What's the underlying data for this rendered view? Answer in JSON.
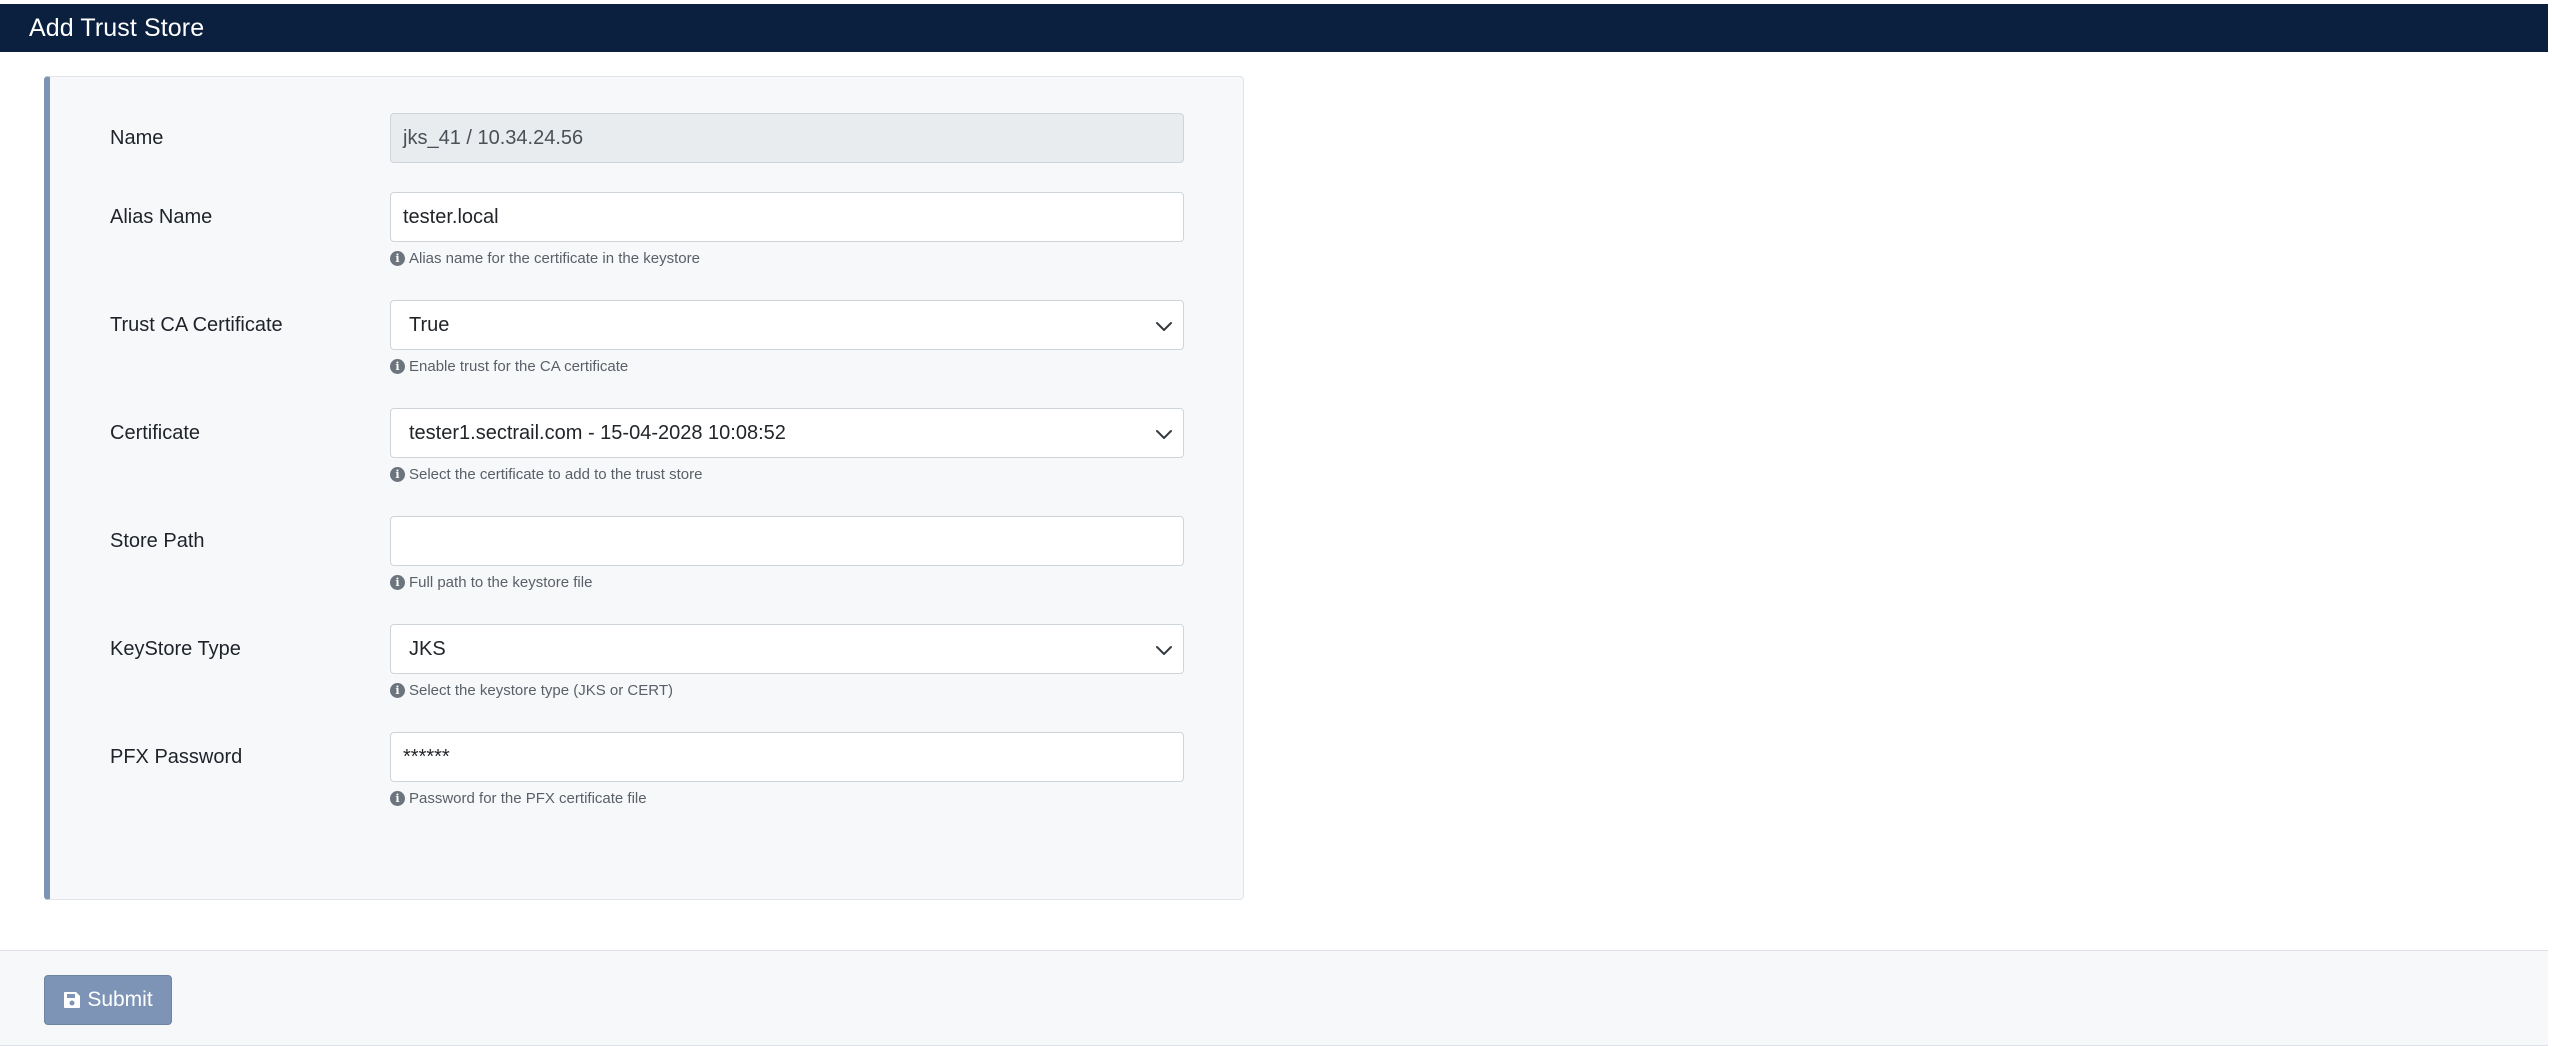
{
  "header": {
    "title": "Add Trust Store"
  },
  "form": {
    "name": {
      "label": "Name",
      "value": "jks_41 / 10.34.24.56"
    },
    "alias_name": {
      "label": "Alias Name",
      "value": "tester.local",
      "help": "Alias name for the certificate in the keystore"
    },
    "trust_ca_certificate": {
      "label": "Trust CA Certificate",
      "selected": "True",
      "help": "Enable trust for the CA certificate"
    },
    "certificate": {
      "label": "Certificate",
      "selected": "tester1.sectrail.com - 15-04-2028 10:08:52",
      "help": "Select the certificate to add to the trust store"
    },
    "store_path": {
      "label": "Store Path",
      "value": "",
      "help": "Full path to the keystore file"
    },
    "keystore_type": {
      "label": "KeyStore Type",
      "selected": "JKS",
      "help": "Select the keystore type (JKS or CERT)"
    },
    "pfx_password": {
      "label": "PFX Password",
      "value": "******",
      "help": "Password for the PFX certificate file"
    }
  },
  "footer": {
    "submit_label": "Submit"
  },
  "icons": {
    "info": "info-circle-icon",
    "dropdown": "chevron-down-icon",
    "submit": "floppy-disk-icon"
  },
  "colors": {
    "header_bg": "#0b1f3f",
    "panel_accent": "#7e94b6",
    "submit_bg": "#7e94b6"
  }
}
